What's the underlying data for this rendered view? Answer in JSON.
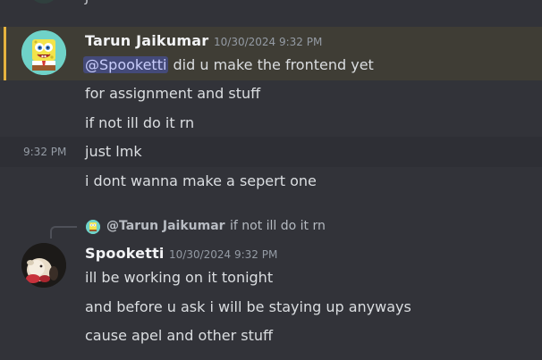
{
  "colors": {
    "background": "#323339",
    "mention_highlight_bg": "#3f3d35",
    "mention_bar": "#e6b33e",
    "mention_pill_bg": "#444a79",
    "mention_pill_text": "#c9cdfb",
    "author_name": "#f2f3f5",
    "message_text": "#dbdee1",
    "timestamp": "#949ba4"
  },
  "prev": {
    "glyph": "J"
  },
  "messages": [
    {
      "author": "Tarun Jaikumar",
      "timestamp": "10/30/2024 9:32 PM",
      "avatar_icon": "spongebob-avatar-icon",
      "mention": "@Spooketti",
      "first_line_rest": " did u make the frontend yet",
      "lines": [
        "for assignment and stuff",
        "if not ill do it rn",
        "just lmk",
        "i dont wanna make a sepert one"
      ],
      "hover_timestamp": "9:32 PM"
    },
    {
      "author": "Spooketti",
      "timestamp": "10/30/2024 9:32 PM",
      "avatar_icon": "chicken-avatar-icon",
      "reply": {
        "author": "@Tarun Jaikumar",
        "text": "if not ill do it rn"
      },
      "lines": [
        "ill be working on it tonight",
        "and before u ask i will be staying up anyways",
        "cause apel and other stuff"
      ]
    }
  ]
}
